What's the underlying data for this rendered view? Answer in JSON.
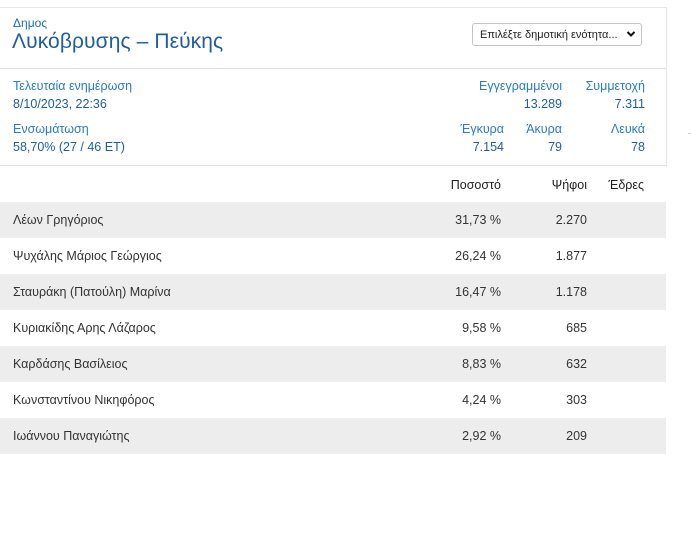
{
  "header": {
    "eyebrow": "Δημος",
    "title": "Λυκόβρυσης – Πεύκης",
    "unit_select_value": "Επιλέξτε δημοτική ενότητα..."
  },
  "stats": {
    "last_update_label": "Τελευταία ενημέρωση",
    "last_update_value": "8/10/2023, 22:36",
    "registered_label": "Εγγεγραμμένοι",
    "registered_value": "13.289",
    "turnout_label": "Συμμετοχή",
    "turnout_value": "7.311",
    "integration_label": "Ενσωμάτωση",
    "integration_value": "58,70% (27 / 46 ΕΤ)",
    "valid_label": "Έγκυρα",
    "valid_value": "7.154",
    "invalid_label": "Άκυρα",
    "invalid_value": "79",
    "blank_label": "Λευκά",
    "blank_value": "78"
  },
  "table": {
    "columns": {
      "percent": "Ποσοστό",
      "votes": "Ψήφοι",
      "seats": "Έδρες"
    },
    "rows": [
      {
        "name": "Λέων Γρηγόριος",
        "percent": "31,73 %",
        "votes": "2.270",
        "seats": ""
      },
      {
        "name": "Ψυχάλης Μάριος Γεώργιος",
        "percent": "26,24 %",
        "votes": "1.877",
        "seats": ""
      },
      {
        "name": "Σταυράκη (Πατούλη) Μαρίνα",
        "percent": "16,47 %",
        "votes": "1.178",
        "seats": ""
      },
      {
        "name": "Κυριακίδης Αρης Λάζαρος",
        "percent": "9,58 %",
        "votes": "685",
        "seats": ""
      },
      {
        "name": "Καρδάσης Βασίλειος",
        "percent": "8,83 %",
        "votes": "632",
        "seats": ""
      },
      {
        "name": "Κωνσταντίνου Νικηφόρος",
        "percent": "4,24 %",
        "votes": "303",
        "seats": ""
      },
      {
        "name": "Ιωάννου Παναγιώτης",
        "percent": "2,92 %",
        "votes": "209",
        "seats": ""
      }
    ]
  },
  "icons": {
    "select_chevron": "chevron-down-icon"
  },
  "colors": {
    "title": "#1f5d9c",
    "label": "#2a7bc4",
    "row_alt": "#ededed"
  }
}
